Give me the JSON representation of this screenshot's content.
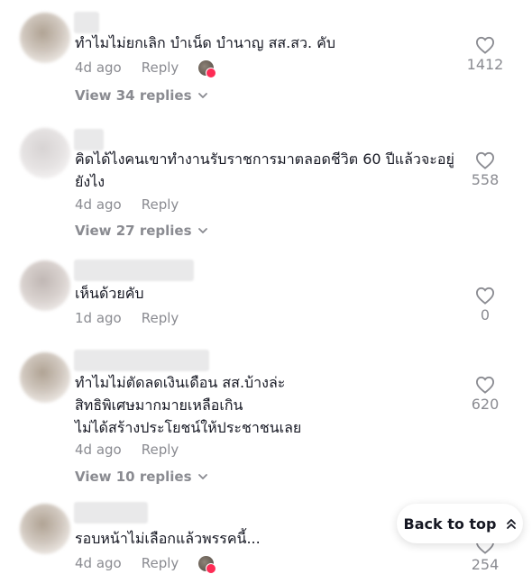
{
  "comments": [
    {
      "text": "ทำไมไม่ยกเลิก บำเน็ด บำนาญ สส.สว. คับ",
      "time": "4d ago",
      "reply_label": "Reply",
      "view_replies": "View 34 replies",
      "likes": "1412",
      "liked_by_creator": true
    },
    {
      "text": "คิดได้ไงคนเขาทำงานรับราชการมาตลอดชีวิต 60 ปีแล้วจะอยู่ยังไง",
      "time": "4d ago",
      "reply_label": "Reply",
      "view_replies": "View 27 replies",
      "likes": "558",
      "liked_by_creator": false
    },
    {
      "text": "เห็นด้วยคับ",
      "time": "1d ago",
      "reply_label": "Reply",
      "likes": "0",
      "liked_by_creator": false
    },
    {
      "text_lines": [
        "ทำไมไม่ตัดลดเงินเดือน สส.บ้างล่ะ",
        "สิทธิพิเศษมากมายเหลือเกิน",
        "ไม่ได้สร้างประโยชน์ให้ประชาชนเลย"
      ],
      "time": "4d ago",
      "reply_label": "Reply",
      "view_replies": "View 10 replies",
      "likes": "620",
      "liked_by_creator": false
    },
    {
      "text": "รอบหน้าไม่เลือกแล้วพรรคนี้...",
      "time": "4d ago",
      "reply_label": "Reply",
      "likes": "254",
      "liked_by_creator": true
    }
  ],
  "back_to_top": "Back to top",
  "icons": {
    "like": "heart-outline-icon",
    "expand": "chevron-down-icon",
    "back_to_top": "double-chevron-up-icon"
  },
  "colors": {
    "text": "#161823",
    "secondary": "#8a8b91",
    "badge": "#fe2c55"
  }
}
